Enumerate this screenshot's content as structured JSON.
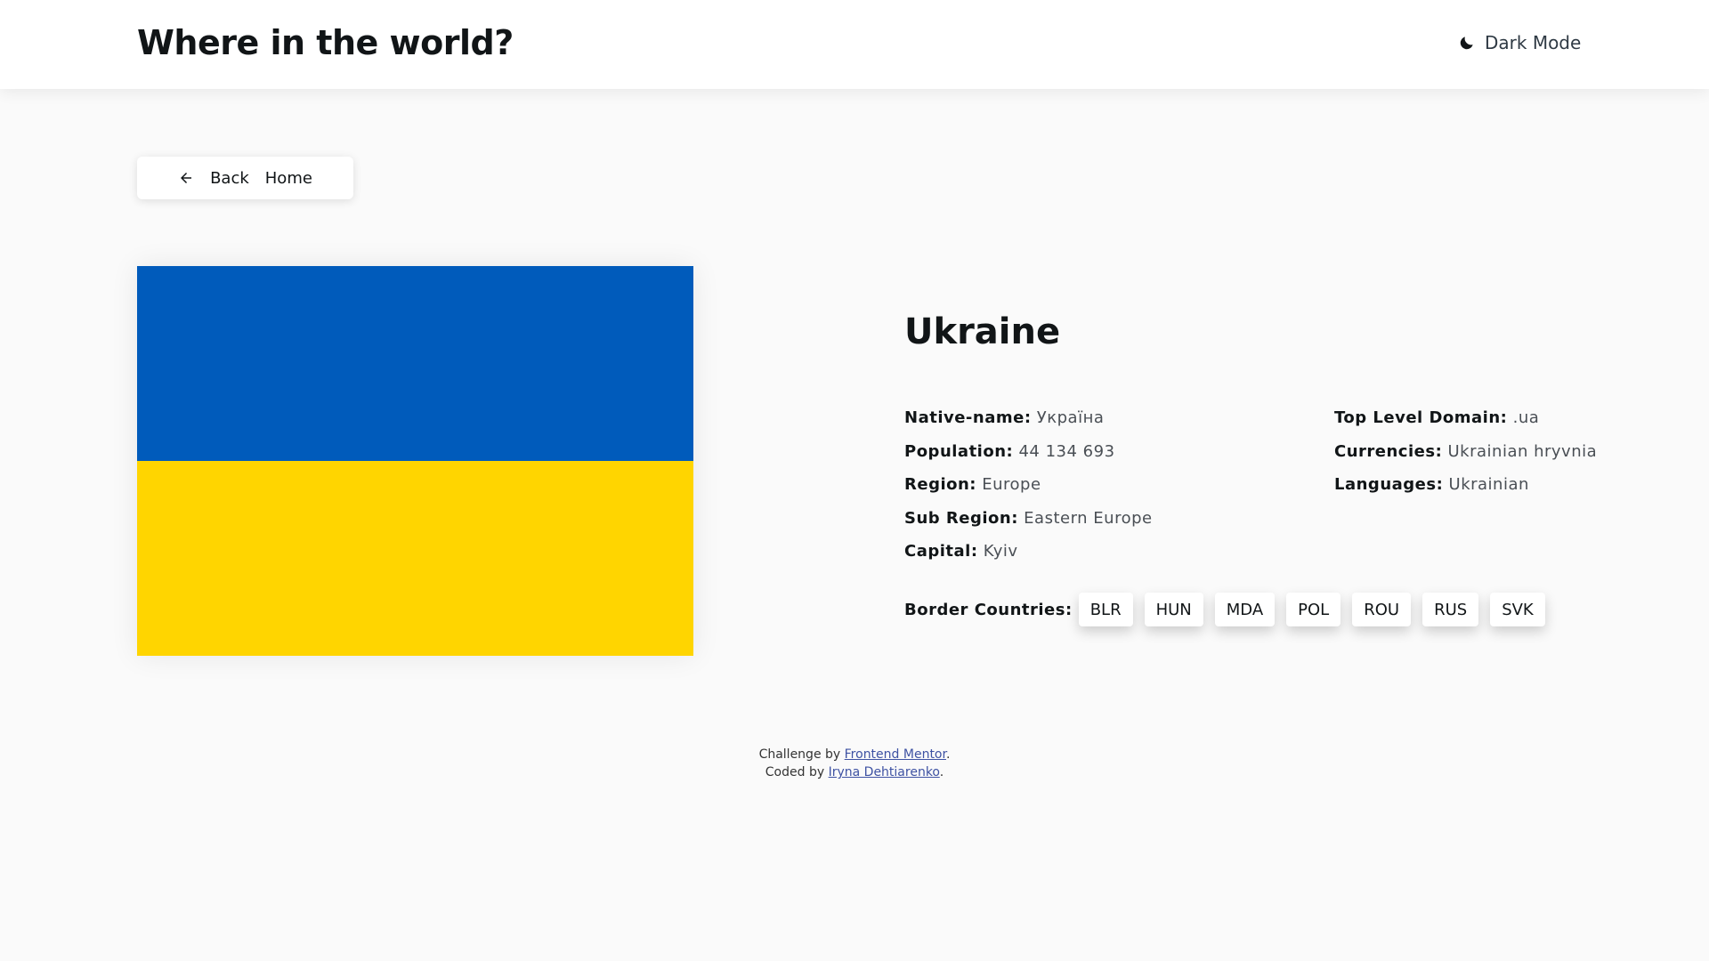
{
  "header": {
    "title": "Where in the world?",
    "theme_toggle": {
      "label": "Dark Mode",
      "icon": "moon-icon"
    }
  },
  "back_button": {
    "label_back": "Back",
    "label_home": "Home",
    "icon": "arrow-left-icon"
  },
  "country": {
    "name": "Ukraine",
    "flag": {
      "top_color": "#005bbb",
      "bottom_color": "#ffd500"
    },
    "details_left": [
      {
        "key": "Native-name:",
        "value": "Україна"
      },
      {
        "key": "Population:",
        "value": "44 134 693"
      },
      {
        "key": "Region:",
        "value": "Europe"
      },
      {
        "key": "Sub Region:",
        "value": "Eastern Europe"
      },
      {
        "key": "Capital:",
        "value": "Kyiv"
      }
    ],
    "details_right": [
      {
        "key": "Top Level Domain:",
        "value": ".ua"
      },
      {
        "key": "Currencies:",
        "value": "Ukrainian hryvnia"
      },
      {
        "key": "Languages:",
        "value": "Ukrainian"
      }
    ],
    "border_label": "Border Countries:",
    "borders": [
      "BLR",
      "HUN",
      "MDA",
      "POL",
      "ROU",
      "RUS",
      "SVK"
    ]
  },
  "footer": {
    "line1_prefix": "Challenge by ",
    "line1_link": "Frontend Mentor",
    "line1_suffix": ".",
    "line2_prefix": "Coded by ",
    "line2_link": "Iryna Dehtiarenko",
    "line2_suffix": "."
  }
}
